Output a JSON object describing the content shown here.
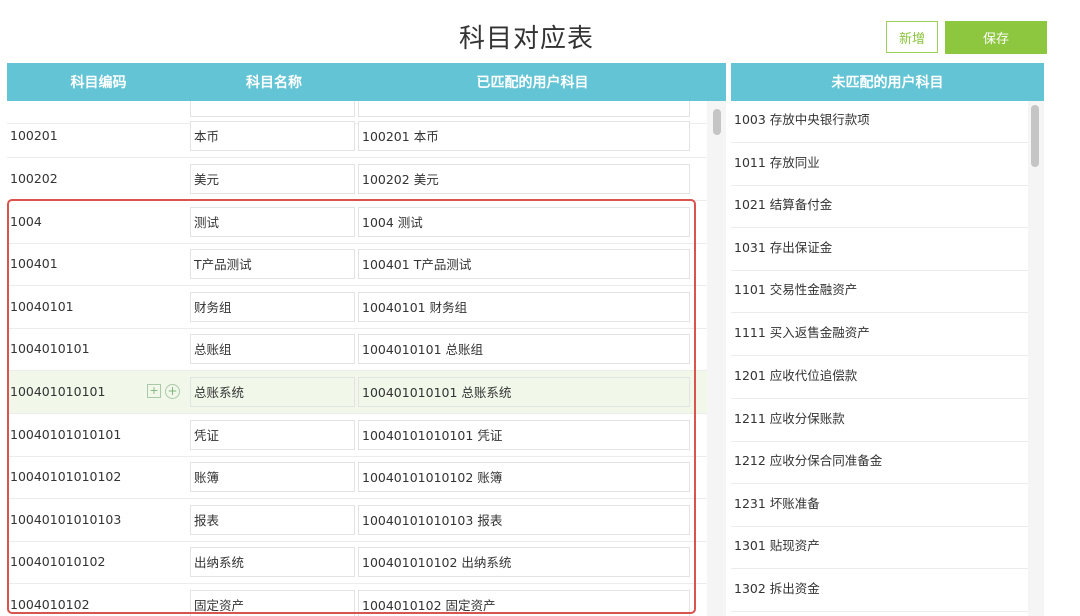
{
  "page": {
    "title": "科目对应表"
  },
  "toolbar": {
    "new_label": "新增",
    "save_label": "保存"
  },
  "left_table": {
    "columns": [
      "科目编码",
      "科目名称",
      "已匹配的用户科目"
    ],
    "rows": [
      {
        "code": "",
        "name": "",
        "matched": ""
      },
      {
        "code": "100201",
        "name": "本币",
        "matched": "100201 本币"
      },
      {
        "code": "100202",
        "name": "美元",
        "matched": "100202 美元"
      },
      {
        "code": "1004",
        "name": "测试",
        "matched": "1004 测试"
      },
      {
        "code": "100401",
        "name": "T产品测试",
        "matched": "100401 T产品测试"
      },
      {
        "code": "10040101",
        "name": "财务组",
        "matched": "10040101 财务组"
      },
      {
        "code": "1004010101",
        "name": "总账组",
        "matched": "1004010101 总账组"
      },
      {
        "code": "100401010101",
        "name": "总账系统",
        "matched": "100401010101 总账系统"
      },
      {
        "code": "10040101010101",
        "name": "凭证",
        "matched": "10040101010101 凭证"
      },
      {
        "code": "10040101010102",
        "name": "账簿",
        "matched": "10040101010102 账簿"
      },
      {
        "code": "10040101010103",
        "name": "报表",
        "matched": "10040101010103 报表"
      },
      {
        "code": "100401010102",
        "name": "出纳系统",
        "matched": "100401010102 出纳系统"
      },
      {
        "code": "1004010102",
        "name": "固定资产",
        "matched": "1004010102 固定资产"
      }
    ]
  },
  "right_table": {
    "header": "未匹配的用户科目",
    "items": [
      "1003 存放中央银行款项",
      "1011 存放同业",
      "1021 结算备付金",
      "1031 存出保证金",
      "1101 交易性金融资产",
      "1111 买入返售金融资产",
      "1201 应收代位追偿款",
      "1211 应收分保账款",
      "1212 应收分保合同准备金",
      "1231 坏账准备",
      "1301 贴现资产",
      "1302 拆出资金"
    ]
  },
  "colors": {
    "header": "#62c4d4",
    "accent": "#8dc63f",
    "highlight_box": "#d9534f"
  }
}
